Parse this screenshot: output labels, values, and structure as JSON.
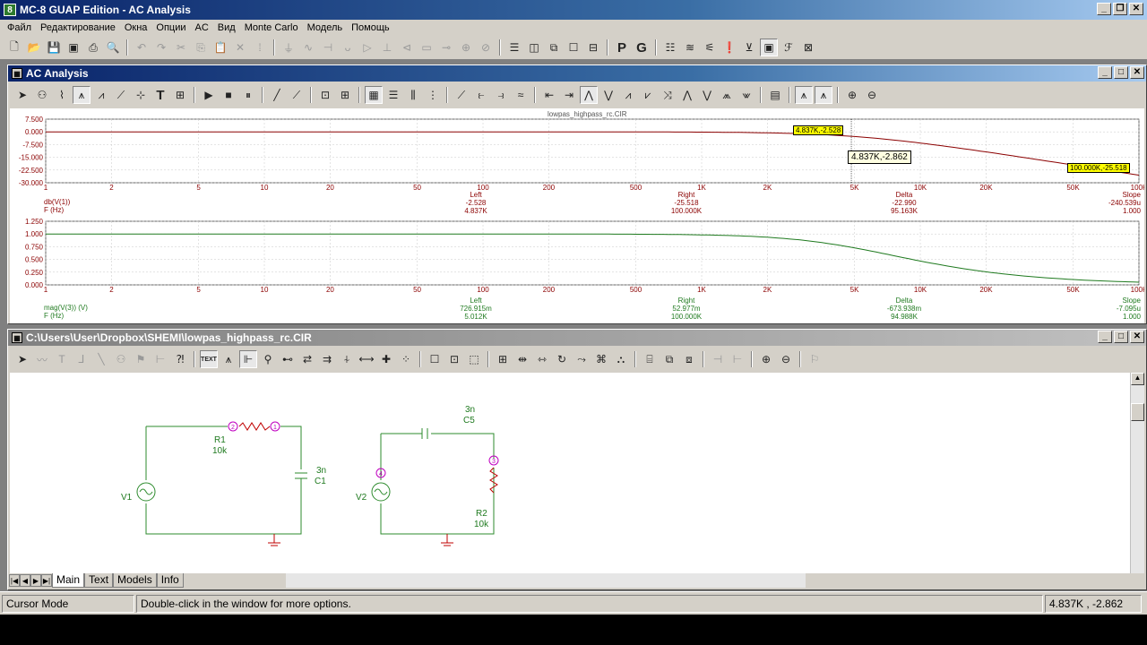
{
  "app": {
    "title": "MC-8 GUAP Edition - AC Analysis",
    "icon_label": "8"
  },
  "menu": [
    "Файл",
    "Редактирование",
    "Окна",
    "Опции",
    "AC",
    "Вид",
    "Monte Carlo",
    "Модель",
    "Помощь"
  ],
  "analysis_window": {
    "title": "AC Analysis",
    "plot1": {
      "file_label": "lowpas_highpass_rc.CIR",
      "y_ticks": [
        "7.500",
        "0.000",
        "-7.500",
        "-15.000",
        "-22.500",
        "-30.000"
      ],
      "x_ticks": [
        "1",
        "2",
        "5",
        "10",
        "20",
        "50",
        "100",
        "200",
        "500",
        "1K",
        "2K",
        "5K",
        "10K",
        "20K",
        "50K",
        "100K"
      ],
      "trace_name": "db(V(1))",
      "x_name": "F (Hz)",
      "cols": {
        "left_h": "Left",
        "left_y": "-2.528",
        "left_x": "4.837K",
        "right_h": "Right",
        "right_y": "-25.518",
        "right_x": "100.000K",
        "delta_h": "Delta",
        "delta_y": "-22.990",
        "delta_x": "95.163K",
        "slope_h": "Slope",
        "slope_y": "-240.539u",
        "slope_x": "1.000"
      },
      "tag_left": "4.837K,-2.528",
      "tag_right": "100.000K,-25.518",
      "tooltip": "4.837K,-2.862"
    },
    "plot2": {
      "y_ticks": [
        "1.250",
        "1.000",
        "0.750",
        "0.500",
        "0.250",
        "0.000"
      ],
      "x_ticks": [
        "1",
        "2",
        "5",
        "10",
        "20",
        "50",
        "100",
        "200",
        "500",
        "1K",
        "2K",
        "5K",
        "10K",
        "20K",
        "50K",
        "100K"
      ],
      "trace_name": "mag(V(3)) (V)",
      "x_name": "F (Hz)",
      "cols": {
        "left_h": "Left",
        "left_y": "726.915m",
        "left_x": "5.012K",
        "right_h": "Right",
        "right_y": "52.977m",
        "right_x": "100.000K",
        "delta_h": "Delta",
        "delta_y": "-673.938m",
        "delta_x": "94.988K",
        "slope_h": "Slope",
        "slope_y": "-7.095u",
        "slope_x": "1.000"
      }
    }
  },
  "schematic_window": {
    "title": "C:\\Users\\User\\Dropbox\\SHEMI\\lowpas_highpass_rc.CIR",
    "text_button": "TEXT",
    "circuit1": {
      "r_name": "R1",
      "r_val": "10k",
      "c_val": "3n",
      "c_name": "C1",
      "v_name": "V1",
      "node_a": "2",
      "node_b": "1"
    },
    "circuit2": {
      "c_val": "3n",
      "c_name": "C5",
      "r_name": "R2",
      "r_val": "10k",
      "v_name": "V2",
      "node_a": "4",
      "node_b": "3"
    },
    "tabs": [
      "Main",
      "Text",
      "Models",
      "Info"
    ]
  },
  "status": {
    "mode": "Cursor Mode",
    "hint": "Double-click in the window for more options.",
    "coords": "4.837K , -2.862"
  },
  "colors": {
    "trace1": "#8b0000",
    "trace2": "#1f7a1f",
    "grid": "#c8c8c8",
    "axis_text": "#8b0000",
    "schematic_wire": "#2e8b2e",
    "node_mark": "#c000c0"
  }
}
